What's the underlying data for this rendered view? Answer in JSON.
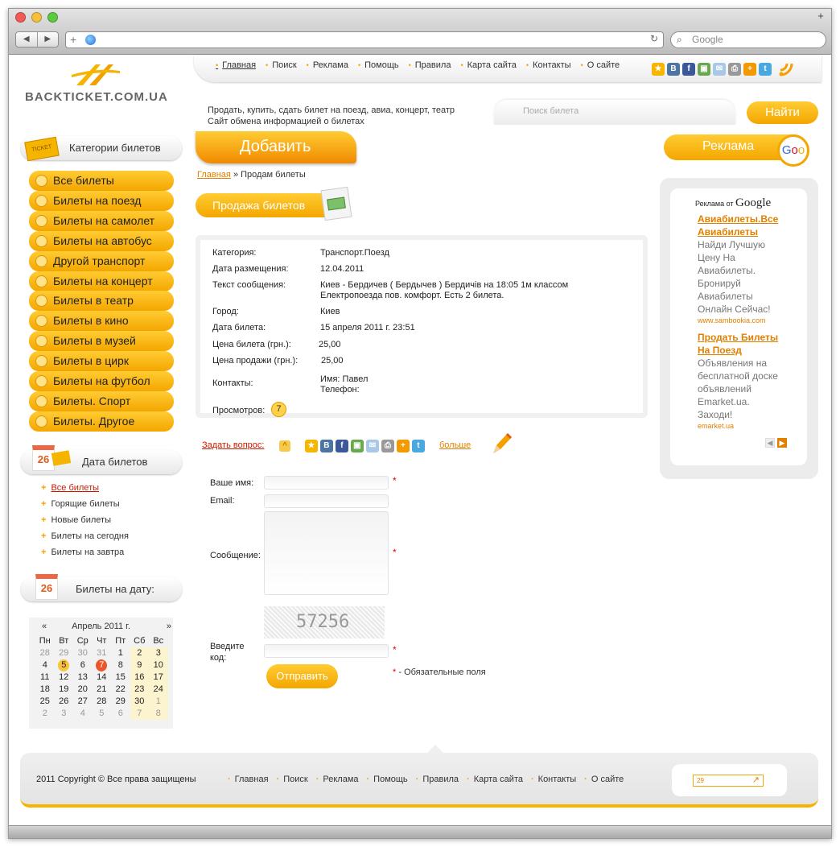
{
  "browser": {
    "search_placeholder": "Google"
  },
  "site": {
    "logo_text": "BACKTICKET.COM.UA",
    "tagline_1": "Продать, купить, сдать билет на поезд, авиа, концерт, театр",
    "tagline_2": "Сайт обмена информацией о билетах",
    "search_placeholder": "Поиск билета",
    "search_button": "Найти"
  },
  "top_nav": [
    "Главная",
    "Поиск",
    "Реклама",
    "Помощь",
    "Правила",
    "Карта сайта",
    "Контакты",
    "О сайте"
  ],
  "share_icons": [
    "star-icon",
    "vkontakte-icon",
    "facebook-icon",
    "photo-icon",
    "mail-icon",
    "print-icon",
    "plus-icon",
    "twitter-icon",
    "rss-icon"
  ],
  "sidebar": {
    "categories_title": "Категории билетов",
    "categories": [
      "Все билеты",
      "Билеты на поезд",
      "Билеты на самолет",
      "Билеты на автобус",
      "Другой транспорт",
      "Билеты на концерт",
      "Билеты в театр",
      "Билеты в кино",
      "Билеты в музей",
      "Билеты в цирк",
      "Билеты на футбол",
      "Билеты. Спорт",
      "Билеты. Другое"
    ],
    "dates_title": "Дата билетов",
    "date_badge": "26",
    "date_links": [
      "Все билеты",
      "Горящие билеты",
      "Новые билеты",
      "Билеты на сегодня",
      "Билеты на завтра"
    ],
    "by_date_title": "Билеты на дату:",
    "calendar": {
      "prev": "«",
      "next": "»",
      "month": "Апрель 2011 г.",
      "weekdays": [
        "Пн",
        "Вт",
        "Ср",
        "Чт",
        "Пт",
        "Сб",
        "Вс"
      ],
      "weeks": [
        [
          "28",
          "29",
          "30",
          "31",
          "1",
          "2",
          "3"
        ],
        [
          "4",
          "5",
          "6",
          "7",
          "8",
          "9",
          "10"
        ],
        [
          "11",
          "12",
          "13",
          "14",
          "15",
          "16",
          "17"
        ],
        [
          "18",
          "19",
          "20",
          "21",
          "22",
          "23",
          "24"
        ],
        [
          "25",
          "26",
          "27",
          "28",
          "29",
          "30",
          "1"
        ],
        [
          "2",
          "3",
          "4",
          "5",
          "6",
          "7",
          "8"
        ]
      ]
    }
  },
  "main": {
    "add_button": "Добавить",
    "breadcrumb_home": "Главная",
    "breadcrumb_sep": "»",
    "breadcrumb_current": "Продам билеты",
    "section_title": "Продажа билетов",
    "details": {
      "category_label": "Категория:",
      "category_value": "Транспорт.Поезд",
      "posted_label": "Дата размещения:",
      "posted_value": "12.04.2011",
      "text_label": "Текст сообщения:",
      "text_value_1": "Киев - Бердичев ( Бердычев ) Бердичів на 18:05 1м классом",
      "text_value_2": "Електропоезда пов. комфорт. Есть 2 билета.",
      "city_label": "Город:",
      "city_value": "Киев",
      "date_label": "Дата билета:",
      "date_value": "15 апреля 2011 г. 23:51",
      "price_label": "Цена билета (грн.):",
      "price_value": "25,00",
      "sale_label": "Цена продажи (грн.):",
      "sale_value": "25,00",
      "contacts_label": "Контакты:",
      "contact_name": "Имя: Павел",
      "contact_phone": "Телефон:",
      "views_label": "Просмотров:",
      "views_value": "7"
    },
    "ask_link": "Задать вопрос:",
    "more_link": "больше",
    "form": {
      "name_label": "Ваше имя:",
      "email_label": "Email:",
      "message_label": "Сообщение:",
      "captcha_value": "57256",
      "code_label_1": "Введите",
      "code_label_2": "код:",
      "submit": "Отправить",
      "required_mark": "*",
      "required_note": "- Обязательные поля"
    }
  },
  "ads": {
    "title": "Реклама",
    "google_prefix": "Реклама от",
    "google_logo": "Google",
    "ad1_title_1": "Авиабилеты.Все",
    "ad1_title_2": "Авиабилеты",
    "ad1_lines": [
      "Найди Лучшую",
      "Цену На",
      "Авиабилеты.",
      "Бронируй",
      "Авиабилеты",
      "Онлайн Сейчас!"
    ],
    "ad1_url": "www.sambookia.com",
    "ad2_title_1": "Продать Билеты",
    "ad2_title_2": "На Поезд",
    "ad2_lines": [
      "Объявления на",
      "бесплатной доске",
      "объявлений",
      "Emarket.ua.",
      "Заходи!"
    ],
    "ad2_url": "emarket.ua"
  },
  "footer": {
    "copyright": "2011 Copyright © Все права защищены",
    "nav": [
      "Главная",
      "Поиск",
      "Реклама",
      "Помощь",
      "Правила",
      "Карта сайта",
      "Контакты",
      "О сайте"
    ],
    "counter": "29"
  },
  "colors": {
    "accent": "#f4a600",
    "link": "#e08000",
    "required": "#e00000"
  }
}
